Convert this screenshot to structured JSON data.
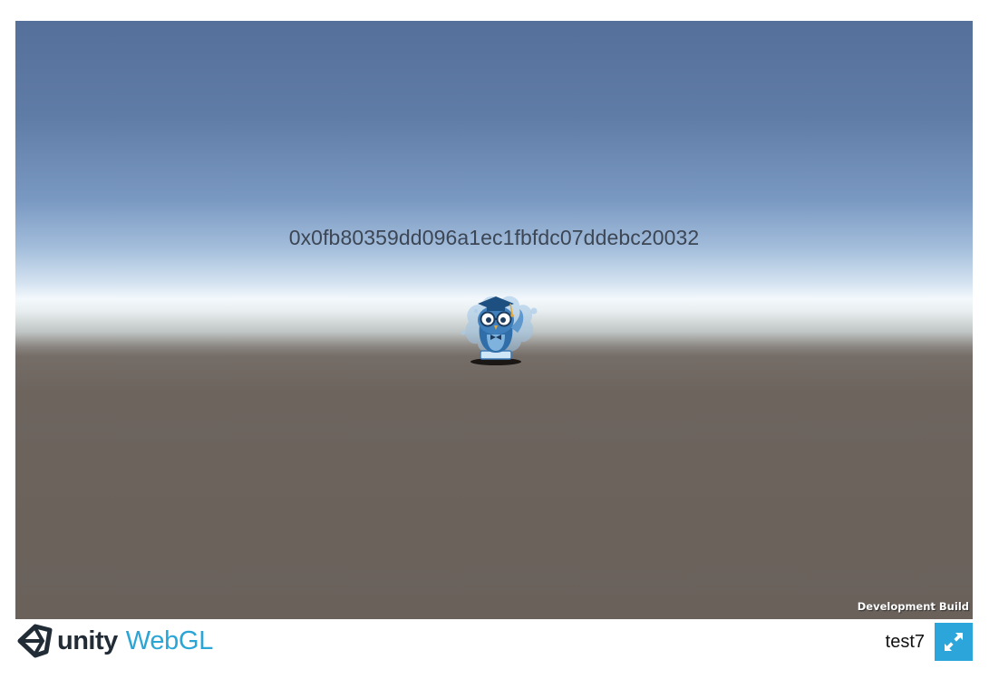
{
  "game": {
    "hash_text": "0x0fb80359dd096a1ec1fbfdc07ddebc20032",
    "dev_build_label": "Development Build",
    "character_icon": "owl-graduate-icon"
  },
  "footer": {
    "logo_unity": "unity",
    "logo_webgl": "WebGL",
    "logo_icon": "unity-logo-icon",
    "build_title": "test7",
    "fullscreen_icon": "fullscreen-icon"
  },
  "colors": {
    "sky_top": "#55709a",
    "horizon": "#f3f8fc",
    "ground": "#6a615b",
    "accent": "#2ca5da",
    "logo_dark": "#222c37"
  }
}
